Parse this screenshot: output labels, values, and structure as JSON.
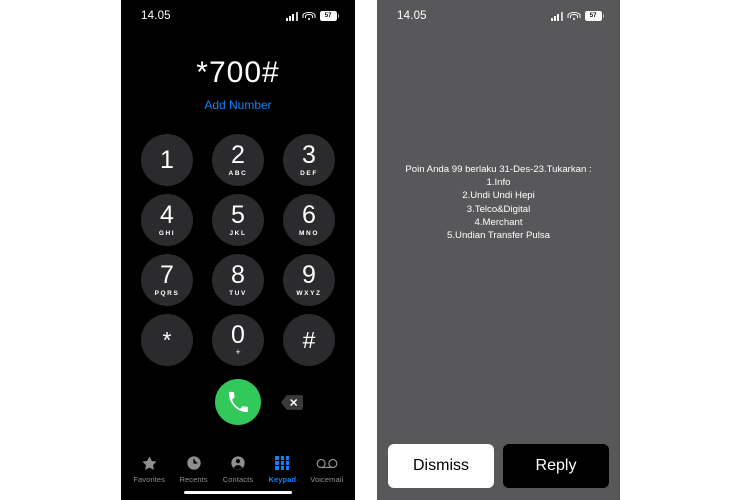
{
  "left_phone": {
    "status_bar": {
      "time": "14.05",
      "battery_level": "57",
      "signal_icon": "cellular-signal-icon",
      "wifi_icon": "wifi-icon",
      "battery_icon": "battery-icon"
    },
    "dialer": {
      "number": "*700#",
      "add_number_label": "Add Number",
      "keys": [
        {
          "digit": "1",
          "sub": ""
        },
        {
          "digit": "2",
          "sub": "ABC"
        },
        {
          "digit": "3",
          "sub": "DEF"
        },
        {
          "digit": "4",
          "sub": "GHI"
        },
        {
          "digit": "5",
          "sub": "JKL"
        },
        {
          "digit": "6",
          "sub": "MNO"
        },
        {
          "digit": "7",
          "sub": "PQRS"
        },
        {
          "digit": "8",
          "sub": "TUV"
        },
        {
          "digit": "9",
          "sub": "WXYZ"
        },
        {
          "digit": "*",
          "sub": ""
        },
        {
          "digit": "0",
          "sub": "+"
        },
        {
          "digit": "#",
          "sub": ""
        }
      ],
      "call_button_icon": "phone-call-icon",
      "delete_button_icon": "backspace-delete-icon",
      "call_button_color": "#32c85a"
    },
    "tabs": [
      {
        "label": "Favorites",
        "icon": "star-icon",
        "active": false
      },
      {
        "label": "Recents",
        "icon": "clock-icon",
        "active": false
      },
      {
        "label": "Contacts",
        "icon": "person-circle-icon",
        "active": false
      },
      {
        "label": "Keypad",
        "icon": "keypad-dots-icon",
        "active": true
      },
      {
        "label": "Voicemail",
        "icon": "voicemail-icon",
        "active": false
      }
    ],
    "accent_color": "#0a84ff",
    "inactive_tab_color": "#8e8e93"
  },
  "right_phone": {
    "status_bar": {
      "time": "14.05",
      "battery_level": "57",
      "signal_icon": "cellular-signal-icon",
      "wifi_icon": "wifi-icon",
      "battery_icon": "battery-icon"
    },
    "ussd_dialog": {
      "message_lines": [
        "Poin Anda 99 berlaku 31-Des-23.Tukarkan :",
        "1.Info",
        "2.Undi Undi Hepi",
        "3.Telco&Digital",
        "4.Merchant",
        "5.Undian Transfer Pulsa"
      ],
      "dismiss_label": "Dismiss",
      "reply_label": "Reply",
      "background_color": "#58585a"
    }
  }
}
